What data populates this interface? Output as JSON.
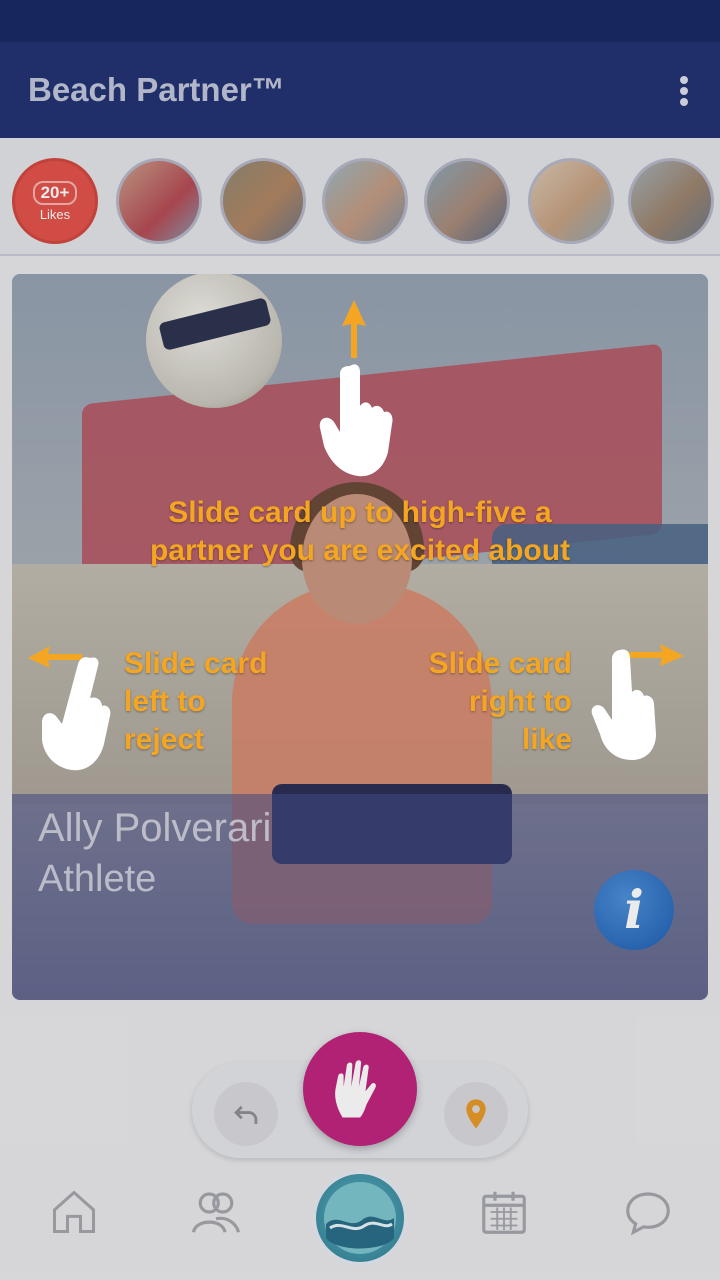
{
  "app": {
    "title": "Beach Partner™"
  },
  "colors": {
    "header": "#233272",
    "status_bar": "#1b2a66",
    "hint": "#f4a623",
    "highfive": "#c0257f",
    "likes_badge": "#e2534a"
  },
  "likes_strip": {
    "badge": {
      "count": "20+",
      "label": "Likes"
    },
    "avatars": [
      "avatar-1",
      "avatar-2",
      "avatar-3",
      "avatar-4",
      "avatar-5",
      "avatar-6"
    ]
  },
  "card": {
    "name": "Ally Polverari",
    "role": "Athlete",
    "info_icon": "info-icon"
  },
  "hints": {
    "up": {
      "line1": "Slide card up to high-five a",
      "line2": "partner you are excited about"
    },
    "left": {
      "line1": "Slide card",
      "line2": "left to",
      "line3": "reject"
    },
    "right": {
      "line1": "Slide card",
      "line2": "right to",
      "line3": "like"
    }
  },
  "actions": {
    "undo_icon": "undo-icon",
    "highfive_icon": "high-five-icon",
    "location_icon": "location-pin-icon"
  },
  "nav": {
    "items": [
      "home-icon",
      "people-icon",
      "beach-partner-logo",
      "calendar-icon",
      "chat-icon"
    ]
  }
}
